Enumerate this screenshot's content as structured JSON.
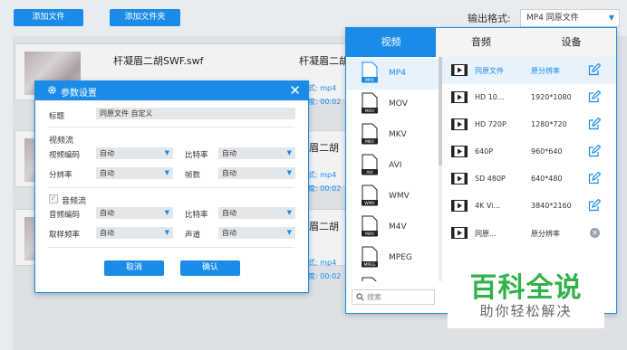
{
  "toolbar": {
    "add_file": "添加文件",
    "add_folder": "添加文件夹",
    "output_format_label": "输出格式:",
    "output_format_value": "MP4 同原文件"
  },
  "files": [
    {
      "name": "杆凝眉二胡SWF.swf",
      "name_partial": "杆凝眉二胡",
      "meta1": "式: mp4",
      "meta2": "度: 00:02"
    },
    {
      "name_partial": "凝眉二胡",
      "meta1": "式: mp4",
      "meta2": "度: 00:02"
    },
    {
      "name_partial": "凝眉二胡",
      "meta1": "式: mp4",
      "meta2": "度: 00:02"
    }
  ],
  "dialog": {
    "title": "参数设置",
    "close": "✕",
    "title_label": "标题",
    "title_value": "同原文件 自定义",
    "video_section": "视频流",
    "video_codec_label": "视频编码",
    "video_codec_value": "自动",
    "video_bitrate_label": "比特率",
    "video_bitrate_value": "自动",
    "resolution_label": "分辨率",
    "resolution_value": "自动",
    "fps_label": "帧数",
    "fps_value": "自动",
    "audio_section": "音频流",
    "audio_codec_label": "音频编码",
    "audio_codec_value": "自动",
    "audio_bitrate_label": "比特率",
    "audio_bitrate_value": "自动",
    "samplerate_label": "取样频率",
    "samplerate_value": "自动",
    "channel_label": "声道",
    "channel_value": "自动",
    "cancel": "取消",
    "confirm": "确认"
  },
  "format_panel": {
    "tabs": [
      "视频",
      "音频",
      "设备"
    ],
    "formats": [
      "MP4",
      "MOV",
      "MKV",
      "AVI",
      "WMV",
      "M4V",
      "MPEG"
    ],
    "icon_labels": [
      "MP4",
      "MOV",
      "MKV",
      "AVI",
      "WMV",
      "M4V",
      "MPEG"
    ],
    "presets": [
      {
        "name": "同原文件",
        "res": "原分辨率",
        "action": "edit"
      },
      {
        "name": "HD 10...",
        "res": "1920*1080",
        "action": "edit"
      },
      {
        "name": "HD 720P",
        "res": "1280*720",
        "action": "edit"
      },
      {
        "name": "640P",
        "res": "960*640",
        "action": "edit"
      },
      {
        "name": "SD 480P",
        "res": "640*480",
        "action": "edit"
      },
      {
        "name": "4K Vi...",
        "res": "3840*2160",
        "action": "edit"
      },
      {
        "name": "同原...",
        "res": "原分辨率",
        "action": "delete"
      }
    ],
    "search_placeholder": "搜索"
  },
  "watermark": {
    "big": "百科全说",
    "small": "助你轻松解决"
  },
  "colors": {
    "accent": "#1a8ce8",
    "watermark_green": "#32b24a"
  }
}
